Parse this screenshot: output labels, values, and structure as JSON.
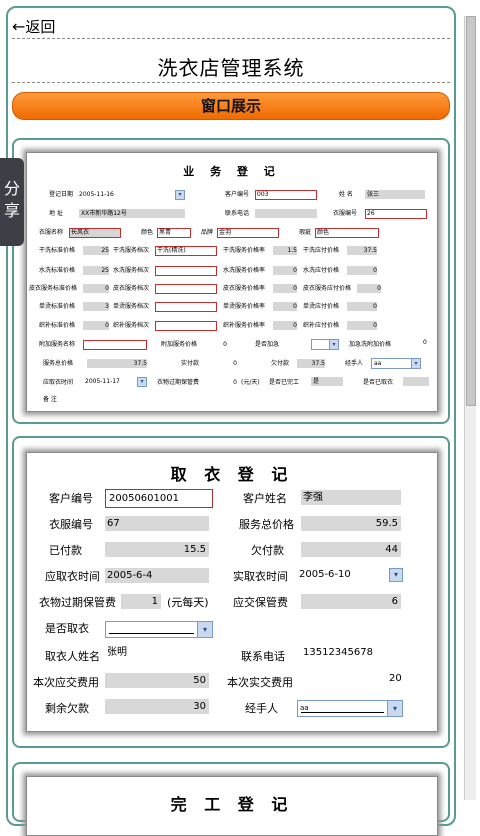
{
  "nav": {
    "back_arrow": "←",
    "back_label": "返回"
  },
  "page_title": "洗衣店管理系统",
  "banner_label": "窗口展示",
  "share_label": "分享",
  "reg": {
    "title": "业 务 登 记",
    "labels": {
      "reg_date": "登记日期",
      "cust_no": "客户编号",
      "name": "姓  名",
      "address": "地  址",
      "phone": "联系电话",
      "cloth_no": "衣服编号",
      "cloth_name": "衣服名称",
      "color": "颜色",
      "brand": "品牌",
      "defect": "瑕疵",
      "dry_std": "干洗标准价格",
      "dry_grade": "干洗服务档次",
      "dry_rate": "干洗服务价格率",
      "dry_pay": "干洗应付价格",
      "wet_std": "水洗标准价格",
      "wet_grade": "水洗服务档次",
      "wet_rate": "水洗服务价格率",
      "wet_pay": "水洗应付价格",
      "leather_std": "皮衣服务标准价格",
      "leather_grade": "皮衣服务档次",
      "leather_rate": "皮衣服务价格率",
      "leather_pay": "皮衣服务应付价格",
      "iron_std": "单烫标准价格",
      "iron_grade": "单烫服务档次",
      "iron_rate": "单烫服务价格率",
      "iron_pay": "单烫应付价格",
      "weave_std": "织补标准价格",
      "weave_grade": "织补服务档次",
      "weave_rate": "织补服务价格率",
      "weave_pay": "织补应付价格",
      "extra_name": "附加服务名称",
      "extra_price": "附加服务价格",
      "urgent": "是否加急",
      "urgent_extra": "加急洗附加价格",
      "total": "服务总价格",
      "paid": "实付款",
      "owed": "欠付款",
      "handler": "经手人",
      "pickup_time": "应取衣时间",
      "storage_fee": "衣物过期保管费",
      "unit": "(元/天)",
      "finished": "是否已完工",
      "taken": "是否已取衣",
      "note": "备  注"
    },
    "values": {
      "reg_date": "2005-11-16",
      "cust_no": "003",
      "name": "张三",
      "address": "XX市新华路12号",
      "cloth_no": "26",
      "cloth_name": "长风衣",
      "color": "黑青",
      "brand": "金羽",
      "defect": "颜色",
      "dry_std": "25",
      "dry_grade": "干洗(精洗)",
      "dry_rate": "1.5",
      "dry_pay": "37.5",
      "wet_std": "25",
      "wet_rate": "0",
      "wet_pay": "0",
      "leather_std": "0",
      "leather_rate": "0",
      "leather_pay": "0",
      "iron_std": "3",
      "iron_rate": "0",
      "iron_pay": "0",
      "weave_std": "0",
      "weave_rate": "0",
      "weave_pay": "0",
      "extra_price": "0",
      "urgent_extra": "0",
      "total": "37.5",
      "paid": "0",
      "owed": "37.5",
      "handler": "aa",
      "pickup_time": "2005-11-17",
      "storage_fee": "0",
      "finished": "是"
    }
  },
  "pickup": {
    "title": "取 衣 登 记",
    "labels": {
      "cust_no": "客户编号",
      "cust_name": "客户姓名",
      "cloth_no": "衣服编号",
      "total": "服务总价格",
      "paid": "已付款",
      "owed": "欠付款",
      "due_time": "应取衣时间",
      "actual_time": "实取衣时间",
      "storage_fee": "衣物过期保管费",
      "unit": "(元每天)",
      "storage_due": "应交保管费",
      "taken": "是否取衣",
      "picker": "取衣人姓名",
      "phone": "联系电话",
      "payable": "本次应交费用",
      "actual_pay": "本次实交费用",
      "balance": "剩余欠款",
      "handler": "经手人"
    },
    "values": {
      "cust_no": "20050601001",
      "cust_name": "李强",
      "cloth_no": "67",
      "total": "59.5",
      "paid": "15.5",
      "owed": "44",
      "due_time": "2005-6-4",
      "actual_time": "2005-6-10",
      "storage_fee": "1",
      "storage_due": "6",
      "picker": "张明",
      "phone": "13512345678",
      "payable": "50",
      "actual_pay": "20",
      "balance": "30",
      "handler": "aa"
    }
  },
  "finish": {
    "title": "完 工 登 记"
  }
}
